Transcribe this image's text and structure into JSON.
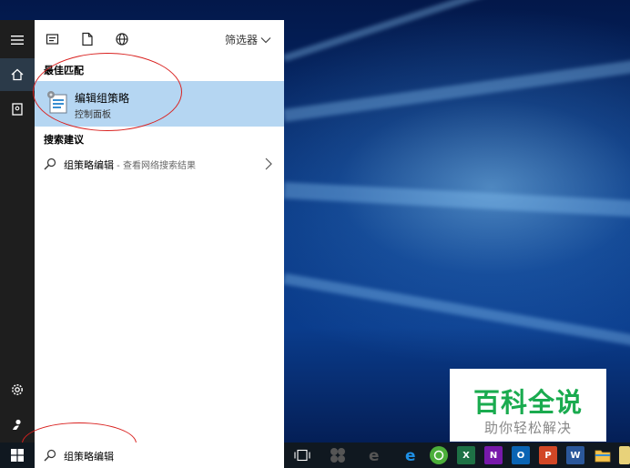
{
  "search_panel": {
    "filter_label": "筛选器",
    "best_match_heading": "最佳匹配",
    "best_match": {
      "title": "编辑组策略",
      "subtitle": "控制面板",
      "icon": "group-policy-editor-icon"
    },
    "suggestions_heading": "搜索建议",
    "suggestion": {
      "query": "组策略编辑",
      "hint": " - 查看网络搜索结果"
    }
  },
  "taskbar": {
    "search_value": "组策略编辑",
    "apps": [
      {
        "name": "task-view",
        "label": ""
      },
      {
        "name": "app-1",
        "label": ""
      },
      {
        "name": "edge",
        "label": "e"
      },
      {
        "name": "ie",
        "label": "e"
      },
      {
        "name": "browser-green",
        "label": ""
      },
      {
        "name": "excel",
        "label": "X"
      },
      {
        "name": "onenote",
        "label": "N"
      },
      {
        "name": "outlook",
        "label": "O"
      },
      {
        "name": "powerpoint",
        "label": "P"
      },
      {
        "name": "word",
        "label": "W"
      },
      {
        "name": "file-explorer",
        "label": ""
      }
    ]
  },
  "watermark": {
    "main": "百科全说",
    "sub": "助你轻松解决"
  },
  "colors": {
    "selection": "#b5d6f2",
    "annotation": "#d9211f",
    "watermark_green": "#1aab4f"
  }
}
